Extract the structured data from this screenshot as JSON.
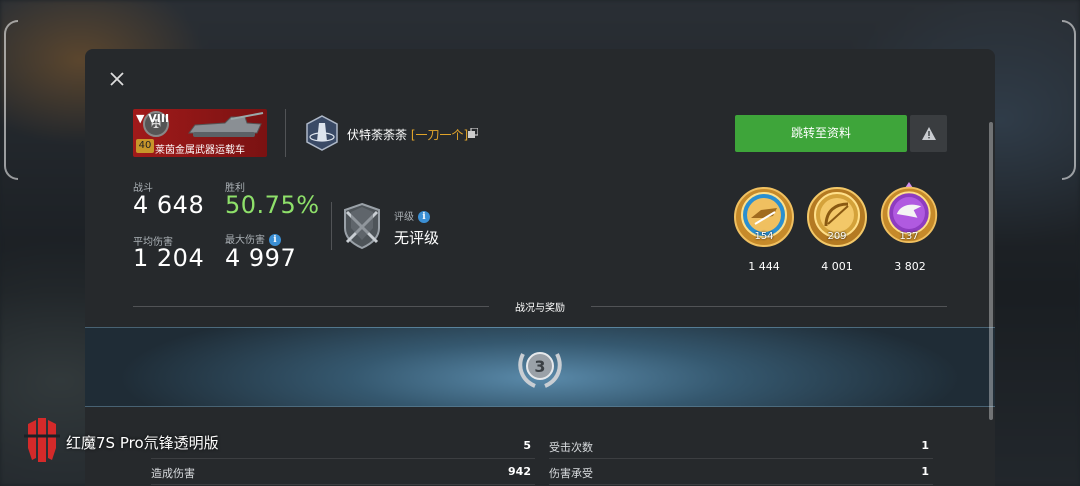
{
  "tank": {
    "tier": "▼ VIII",
    "level": "40",
    "name": "莱茵金属武器运载车"
  },
  "player": {
    "name": "伏特荼荼荼",
    "clan": "[一刀一个]"
  },
  "actions": {
    "goto_profile": "跳转至资料"
  },
  "stats": {
    "battles_label": "战斗",
    "battles_value": "4 648",
    "winrate_label": "胜利",
    "winrate_value": "50.75%",
    "avg_damage_label": "平均伤害",
    "avg_damage_value": "1 204",
    "max_damage_label": "最大伤害",
    "max_damage_value": "4 997",
    "rating_label": "评级",
    "rating_value": "无评级"
  },
  "medals": [
    {
      "icon": "tank-destroyer-medal-icon",
      "count": "154",
      "total": "1 444",
      "color": "#2a8fd0"
    },
    {
      "icon": "bow-medal-icon",
      "count": "209",
      "total": "4 001",
      "color": "#d4a23a"
    },
    {
      "icon": "eagle-medal-icon",
      "count": "137",
      "total": "3 802",
      "color": "#8e3cc0"
    }
  ],
  "section": {
    "title": "战况与奖励",
    "mastery_level": "3"
  },
  "table": {
    "left": [
      {
        "label": "",
        "value": "5"
      },
      {
        "label": "造成伤害",
        "value": "942"
      }
    ],
    "right": [
      {
        "label": "受击次数",
        "value": "1"
      },
      {
        "label": "伤害承受",
        "value": "1"
      }
    ]
  },
  "watermark": {
    "text": "红魔7S Pro氘锋透明版"
  },
  "colors": {
    "accent_green": "#3ea53a",
    "winrate_green": "#8ee06a",
    "clan_orange": "#e3a52b",
    "tank_red": "#a01a1a"
  }
}
